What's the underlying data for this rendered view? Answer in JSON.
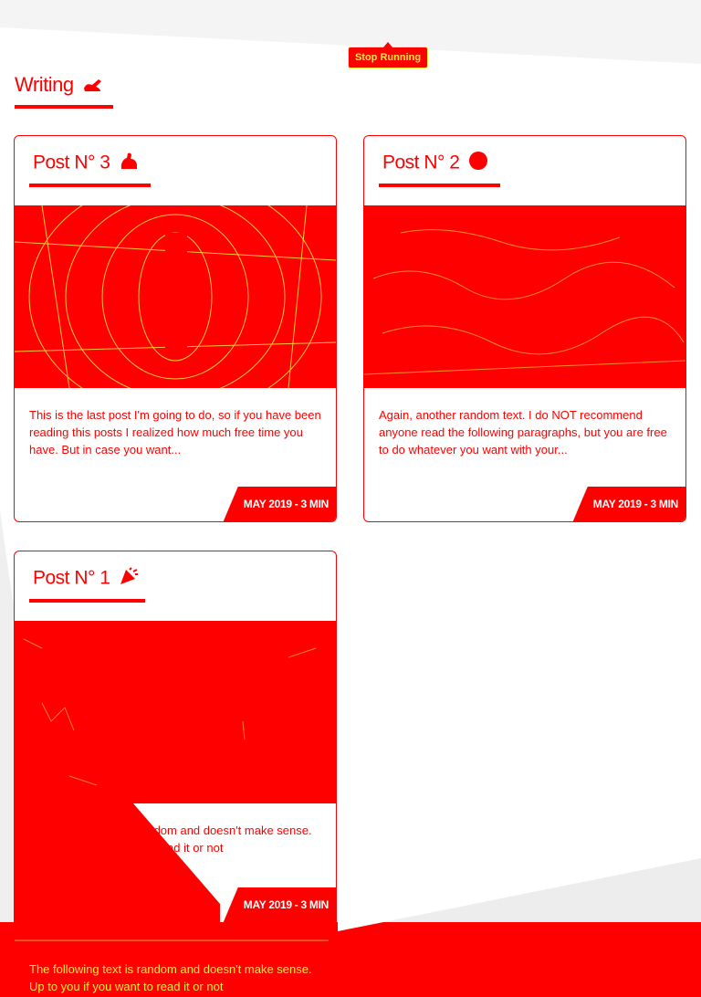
{
  "toolbar": {
    "stop_label": "Stop Running"
  },
  "section": {
    "title": "Writing"
  },
  "posts": [
    {
      "title": "Post N° 3",
      "icon": "flexed-arm-icon",
      "excerpt": "This is the last post I'm going to do, so if you have been reading this posts I realized how much free time you have. But in case you want...",
      "meta": "MAY 2019 - 3 MIN"
    },
    {
      "title": "Post N° 2",
      "icon": "red-circle-icon",
      "excerpt": "Again, another random text. I do NOT recommend anyone read the following paragraphs, but you are free to do whatever you want with your...",
      "meta": "MAY 2019 - 3 MIN"
    },
    {
      "title": "Post N° 1",
      "icon": "party-popper-icon",
      "excerpt": "The following text is random and doesn't make sense. Up to you if you want to read it or not",
      "meta": "MAY 2019 - 3 MIN"
    }
  ],
  "ghost_excerpt": "The following text is random and doesn't make sense. Up to you if you want to read it or not",
  "colors": {
    "primary": "#ff0000",
    "accent": "#ffeb3b",
    "background": "#ffffff"
  }
}
